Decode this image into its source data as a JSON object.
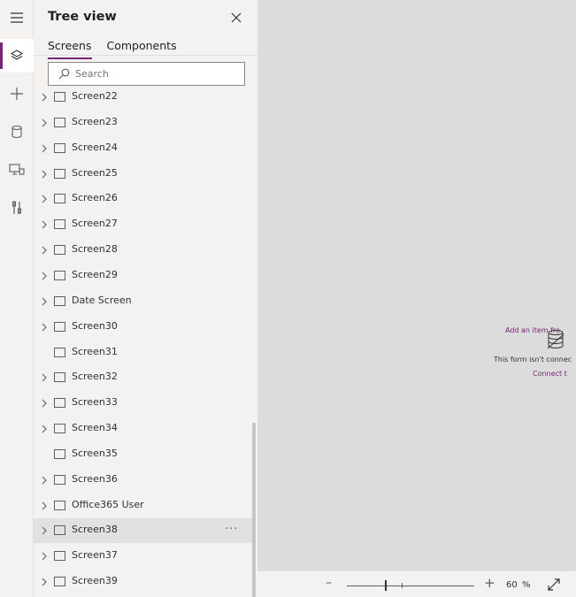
{
  "panel": {
    "title": "Tree view",
    "tabs": [
      {
        "label": "Screens",
        "active": true
      },
      {
        "label": "Components",
        "active": false
      }
    ],
    "search_placeholder": "Search"
  },
  "rail": [
    {
      "icon": "hamburger-menu-icon"
    },
    {
      "icon": "layers-icon",
      "active": true
    },
    {
      "icon": "plus-icon"
    },
    {
      "icon": "database-icon"
    },
    {
      "icon": "media-icon"
    },
    {
      "icon": "tools-icon"
    }
  ],
  "screens": [
    {
      "label": "Screen22",
      "expandable": true
    },
    {
      "label": "Screen23",
      "expandable": true
    },
    {
      "label": "Screen24",
      "expandable": true
    },
    {
      "label": "Screen25",
      "expandable": true
    },
    {
      "label": "Screen26",
      "expandable": true
    },
    {
      "label": "Screen27",
      "expandable": true
    },
    {
      "label": "Screen28",
      "expandable": true
    },
    {
      "label": "Screen29",
      "expandable": true
    },
    {
      "label": "Date Screen",
      "expandable": true
    },
    {
      "label": "Screen30",
      "expandable": true
    },
    {
      "label": "Screen31",
      "expandable": false
    },
    {
      "label": "Screen32",
      "expandable": true
    },
    {
      "label": "Screen33",
      "expandable": true
    },
    {
      "label": "Screen34",
      "expandable": true
    },
    {
      "label": "Screen35",
      "expandable": false
    },
    {
      "label": "Screen36",
      "expandable": true
    },
    {
      "label": "Office365 User",
      "expandable": true
    },
    {
      "label": "Screen38",
      "expandable": true,
      "selected": true,
      "more": "···"
    },
    {
      "label": "Screen37",
      "expandable": true
    },
    {
      "label": "Screen39",
      "expandable": true
    }
  ],
  "canvas": {
    "form_add": "Add an item fro",
    "form_text": "This form isn't connec",
    "form_connect": "Connect t"
  },
  "zoom": {
    "minus": "–",
    "plus": "+",
    "value": "60",
    "unit": "%",
    "level_fraction": 0.3
  },
  "colors": {
    "accent": "#742774",
    "panel_bg": "#f3f2f1",
    "canvas_bg": "#dcdcdc",
    "selected_row": "#e1e1e1"
  }
}
